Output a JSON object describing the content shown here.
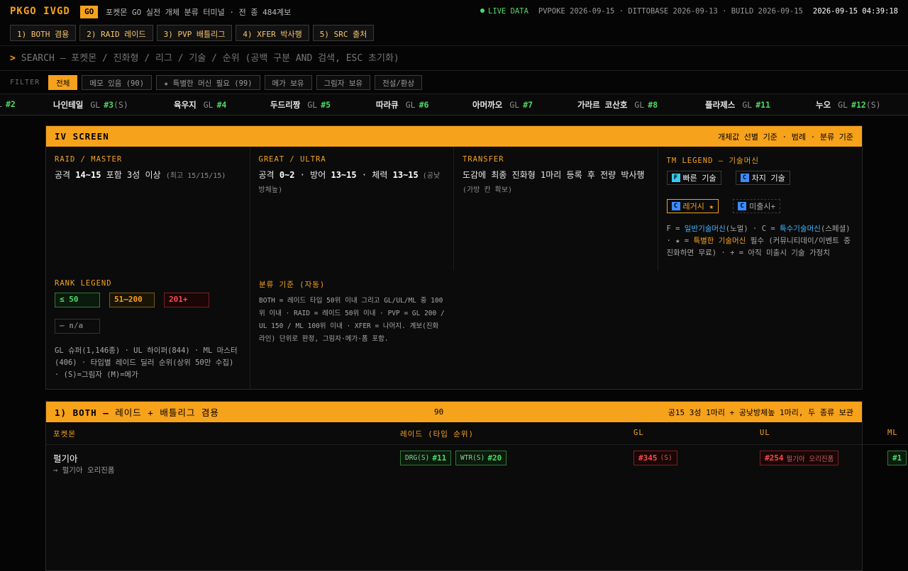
{
  "header": {
    "brand": "PKGO IVGD",
    "badge": "GO",
    "subtitle": "포켓몬 GO 실전 개체 분류 터미널 · 전 종 484계보",
    "live": "LIVE DATA",
    "versions": "PVPOKE 2026-09-15 · DITTOBASE 2026-09-13 · BUILD 2026-09-15",
    "clock": "2026-09-15 04:39:18",
    "tabs": [
      "1) BOTH 겸용",
      "2) RAID 레이드",
      "3) PVP 배틀리그",
      "4) XFER 박사행",
      "5) SRC 출처"
    ]
  },
  "search": {
    "prompt": ">",
    "placeholder": "SEARCH — 포켓몬 / 진화형 / 리그 / 기술 / 순위 (공백 구분 AND 검색, ESC 초기화)"
  },
  "filter": {
    "label": "FILTER",
    "chips": [
      "전체",
      "메모 있음 (90)",
      "★ 특별한 머신 필요 (99)",
      "메가 보유",
      "그림자 보유",
      "전설/환상"
    ]
  },
  "ticker": [
    {
      "name": "",
      "league": "L",
      "rank": "#2",
      "suffix": ""
    },
    {
      "name": "나인테일",
      "league": "GL",
      "rank": "#3",
      "suffix": "(S)"
    },
    {
      "name": "육우지",
      "league": "GL",
      "rank": "#4",
      "suffix": ""
    },
    {
      "name": "두드리짱",
      "league": "GL",
      "rank": "#5",
      "suffix": ""
    },
    {
      "name": "따라큐",
      "league": "GL",
      "rank": "#6",
      "suffix": ""
    },
    {
      "name": "아머까오",
      "league": "GL",
      "rank": "#7",
      "suffix": ""
    },
    {
      "name": "가라르 코산호",
      "league": "GL",
      "rank": "#8",
      "suffix": ""
    },
    {
      "name": "플라제스",
      "league": "GL",
      "rank": "#11",
      "suffix": ""
    },
    {
      "name": "누오",
      "league": "GL",
      "rank": "#12",
      "suffix": "(S)"
    }
  ],
  "iv": {
    "title": "IV SCREEN",
    "note": "개체값 선별 기준 · 범례 · 분류 기준",
    "raid": {
      "label": "RAID / MASTER",
      "pre": "공격 ",
      "b1": "14~15",
      "post": " 포함 3성 이상 ",
      "small": "(최고 15/15/15)"
    },
    "great": {
      "label": "GREAT / ULTRA",
      "pre": "공격 ",
      "b1": "0~2",
      "mid1": " · 방어 ",
      "b2": "13~15",
      "mid2": " · 체력 ",
      "b3": "13~15",
      "small": " (공낮방체높)"
    },
    "transfer": {
      "label": "TRANSFER",
      "text": "도감에 최종 진화형 1마리 등록 후 전량 박사행",
      "small": " (가방 칸 확보)"
    },
    "tm": {
      "label": "TM LEGEND — 기술머신",
      "fast": {
        "k": "F",
        "text": "빠른 기술"
      },
      "charged": {
        "k": "C",
        "text": "차지 기술"
      },
      "legacy": {
        "k": "C",
        "text": "레거시 ★"
      },
      "unreleased": {
        "k": "C",
        "text": "미출시+"
      },
      "desc_a": "F = ",
      "desc_fast": "일반기술머신",
      "desc_b": "(노멀) · C = ",
      "desc_charged": "특수기술머신",
      "desc_c": "(스페셜) · ★ = ",
      "desc_elite": "특별한 기술머신",
      "desc_d": " 필수 (커뮤니티데이/이벤트 중 진화하면 무료) · + = 아직 미출시 기술 가정치"
    },
    "rank": {
      "label": "RANK LEGEND",
      "good": "≤ 50",
      "mid": "51–200",
      "bad": "201+",
      "na": "— n/a",
      "desc": "GL 슈퍼(1,146종) · UL 하이퍼(844) · ML 마스터(406) · 타입별 레이드 딜러 순위(상위 50만 수집) · (S)=그림자 (M)=메가"
    },
    "auto": {
      "label": "분류 기준 (자동)",
      "desc": "BOTH = 레이드 타입 50위 이내 그리고 GL/UL/ML 중 100위 이내 · RAID = 레이드 50위 이내 · PVP = GL 200 / UL 150 / ML 100위 이내 · XFER = 나머지. 계보(진화 라인) 단위로 판정, 그림자·메가·폼 포함."
    }
  },
  "both": {
    "title": "1) BOTH — ",
    "title2": "레이드 + 배틀리그 겸용",
    "count": "90",
    "note": "공15 3성 1마리 + 공낮방체높 1마리, 두 종류 보관",
    "headers": {
      "pokemon": "포켓몬",
      "raid": "레이드 (타입 순위)",
      "gl": "GL",
      "ul": "UL",
      "ml": "ML"
    },
    "rows": [
      {
        "name": "펄기아",
        "sub": "→ 펄기아 오리진폼",
        "raid1_t": "DRG(S)",
        "raid1_r": "#11",
        "raid2_t": "WTR(S)",
        "raid2_r": "#20",
        "gl_r": "#345",
        "gl_s": "(S)",
        "ul_r": "#254",
        "ul_s": "펄기아 오리진폼",
        "ml_r": "#1"
      }
    ]
  },
  "colors": {
    "accent": "#f7a21b",
    "good": "#4cd964",
    "bad": "#ff4a4a",
    "bg": "#050505"
  }
}
